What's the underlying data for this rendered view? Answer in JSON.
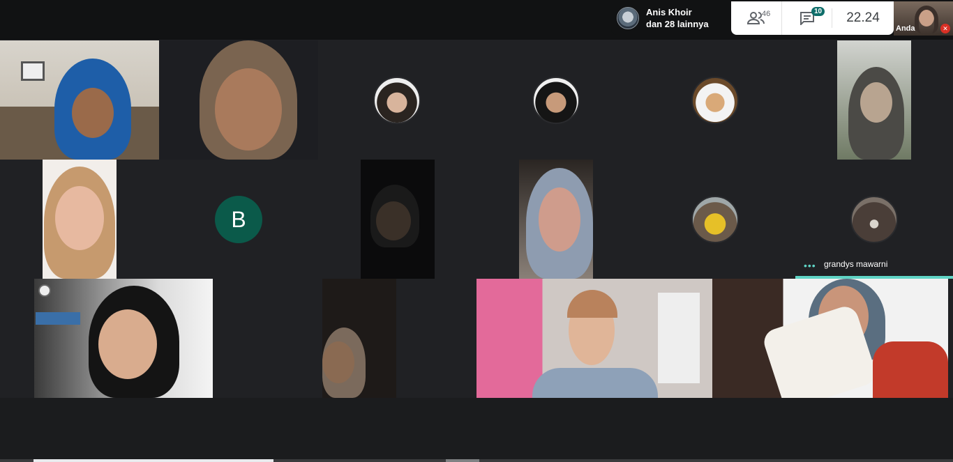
{
  "presenter": {
    "name": "Anis Khoir",
    "others": "dan 28 lainnya"
  },
  "controls": {
    "people_count": "46",
    "chat_badge": "10",
    "time": "22.24"
  },
  "self_tile": {
    "label": "Anda"
  },
  "letter_avatar": {
    "letter": "B"
  },
  "active_speaker": {
    "name": "grandys mawarni",
    "dots": "•••"
  },
  "colors": {
    "accent": "#5fd4c5",
    "avatar_green": "#0b5a4a",
    "badge": "#0f6e6a",
    "mic_off": "#d93025"
  },
  "icons": [
    "people-icon",
    "chat-icon",
    "mic-off-icon",
    "speaking-dots-icon"
  ]
}
